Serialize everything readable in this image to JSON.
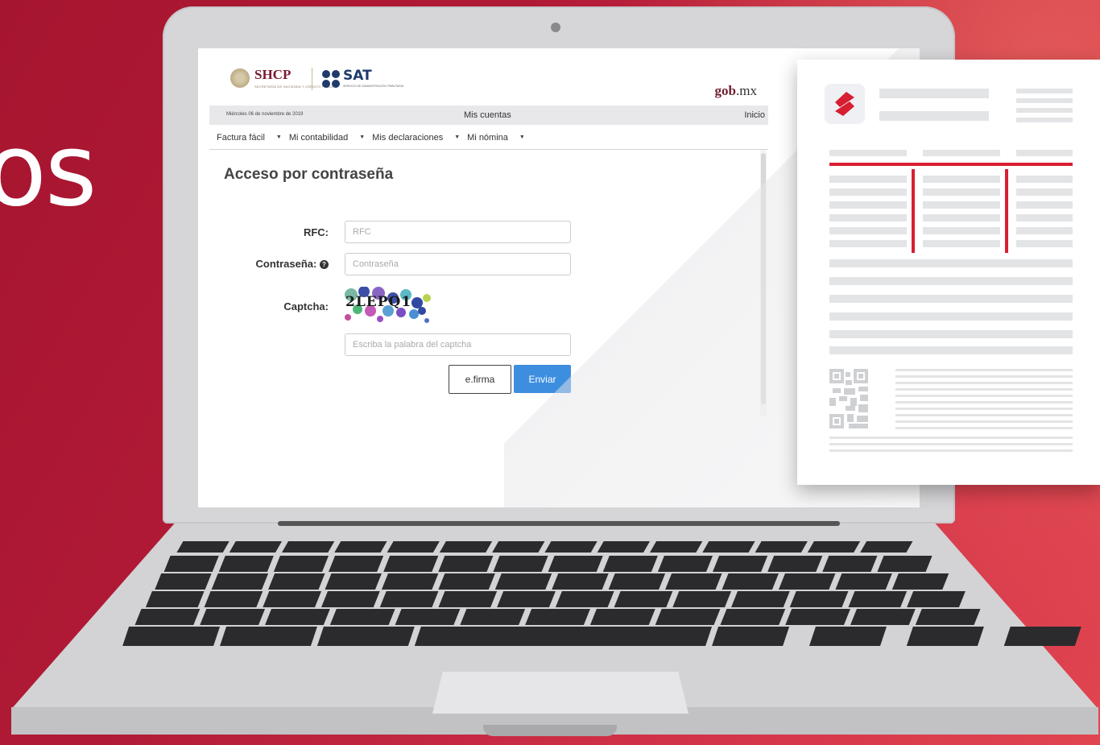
{
  "background": {
    "big_text": "os",
    "accent": "#b11a36"
  },
  "header": {
    "shcp": "SHCP",
    "shcp_sub": "SECRETARÍA DE HACIENDA Y CRÉDITO PÚBLICO",
    "sat": "SAT",
    "sat_sub": "SERVICIO DE ADMINISTRACIÓN TRIBUTARIA",
    "gob_prefix": "gob",
    "gob_suffix": ".mx"
  },
  "infobar": {
    "date": "Miércoles 06 de noviembre de 2019",
    "mis_cuentas": "Mis cuentas",
    "inicio": "Inicio"
  },
  "menu": [
    {
      "label": "Factura fácil"
    },
    {
      "label": "Mi contabilidad"
    },
    {
      "label": "Mis declaraciones"
    },
    {
      "label": "Mi nómina"
    }
  ],
  "form": {
    "title": "Acceso por contraseña",
    "rfc_label": "RFC:",
    "rfc_placeholder": "RFC",
    "password_label": "Contraseña:",
    "password_placeholder": "Contraseña",
    "captcha_label": "Captcha:",
    "captcha_text": "2LEPQ1",
    "captcha_placeholder": "Escriba la palabra del captcha",
    "efirma_label": "e.firma",
    "enviar_label": "Enviar"
  },
  "colors": {
    "primary_button": "#3e8ee0",
    "brand_red": "#d81e32",
    "sat_blue": "#1f3a6b"
  }
}
